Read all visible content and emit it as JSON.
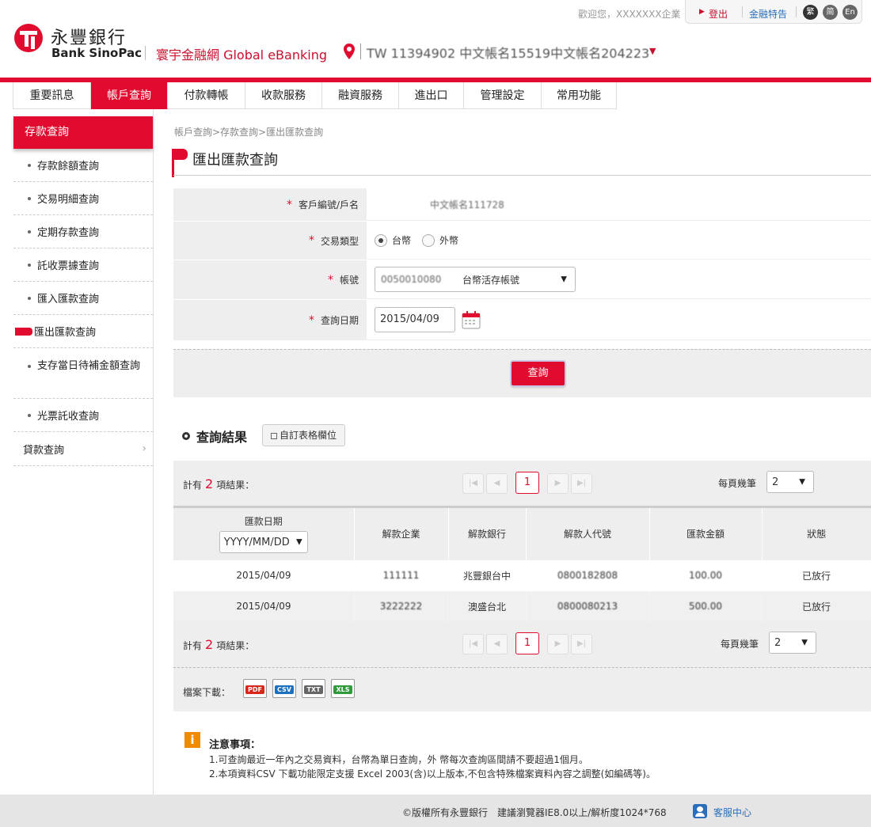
{
  "header": {
    "bank_name_zh": "永豐銀行",
    "bank_name_en": "Bank SinoPac",
    "portal_name": "寰宇金融網 Global eBanking",
    "account_selector": "TW 11394902 中文帳名15519中文帳名204223",
    "welcome": "歡迎您，XXXXXXX企業",
    "logout": "登出",
    "calendar": "金融特告",
    "langs": [
      "繁",
      "简",
      "En"
    ]
  },
  "nav": [
    "重要訊息",
    "帳戶查詢",
    "付款轉帳",
    "收款服務",
    "融資服務",
    "進出口",
    "管理設定",
    "常用功能"
  ],
  "sidebar": {
    "head": "存款查詢",
    "items": [
      "存款餘額查詢",
      "交易明細查詢",
      "定期存款查詢",
      "託收票據查詢",
      "匯入匯款查詢",
      "匯出匯款查詢",
      "支存當日待補金額查詢",
      "光票託收查詢"
    ],
    "loan": "貸款查詢"
  },
  "breadcrumb": "帳戶查詢>存款查詢>匯出匯款查詢",
  "page_title": "匯出匯款查詢",
  "form": {
    "customer_label": "客戶編號/戶名",
    "customer_value": "中文帳名111728",
    "type_label": "交易類型",
    "type_twd": "台幣",
    "type_fx": "外幣",
    "account_label": "帳號",
    "account_no": "0050010080",
    "account_desc": "台幣活存帳號",
    "date_label": "查詢日期",
    "date_value": "2015/04/09",
    "submit": "查詢"
  },
  "results": {
    "title": "查詢結果",
    "custom_columns": "自訂表格欄位",
    "count_prefix": "計有",
    "count": "2",
    "count_suffix": "項結果：",
    "current_page": "1",
    "per_page_label": "每頁幾筆",
    "per_page": "2",
    "columns": [
      "匯款日期",
      "解款企業",
      "解款銀行",
      "解款人代號",
      "匯款金額",
      "狀態"
    ],
    "date_format": "YYYY/MM/DD",
    "rows": [
      [
        "2015/04/09",
        "111111",
        "兆豐銀台中",
        "0800182808",
        "100.00",
        "已放行"
      ],
      [
        "2015/04/09",
        "3222222",
        "澳盛台北",
        "0800080213",
        "500.00",
        "已放行"
      ]
    ]
  },
  "download": {
    "label": "檔案下載：",
    "formats": [
      "PDF",
      "CSV",
      "TXT",
      "XLS"
    ]
  },
  "notice": {
    "title": "注意事項：",
    "lines": [
      "1.可查詢最近一年內之交易資料，台幣為單日查詢，外 幣每次查詢區間請不要超過1個月。",
      "2.本項資料CSV 下載功能限定支援 Excel 2003(含)以上版本,不包含特殊檔案資料內容之調整(如編碼等)。"
    ]
  },
  "footer": {
    "text": "©版權所有永豐銀行　建議瀏覽器IE8.0以上/解析度1024*768",
    "service": "客服中心"
  },
  "colors": {
    "brand_red": "#e00b2f",
    "link_blue": "#2a6ebb",
    "notice_orange": "#f08a00"
  }
}
